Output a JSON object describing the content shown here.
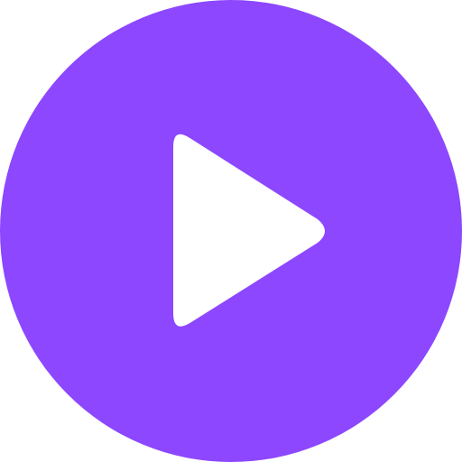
{
  "play_button": {
    "icon": "play-icon",
    "background_color": "#8c47ff",
    "icon_color": "#ffffff"
  }
}
